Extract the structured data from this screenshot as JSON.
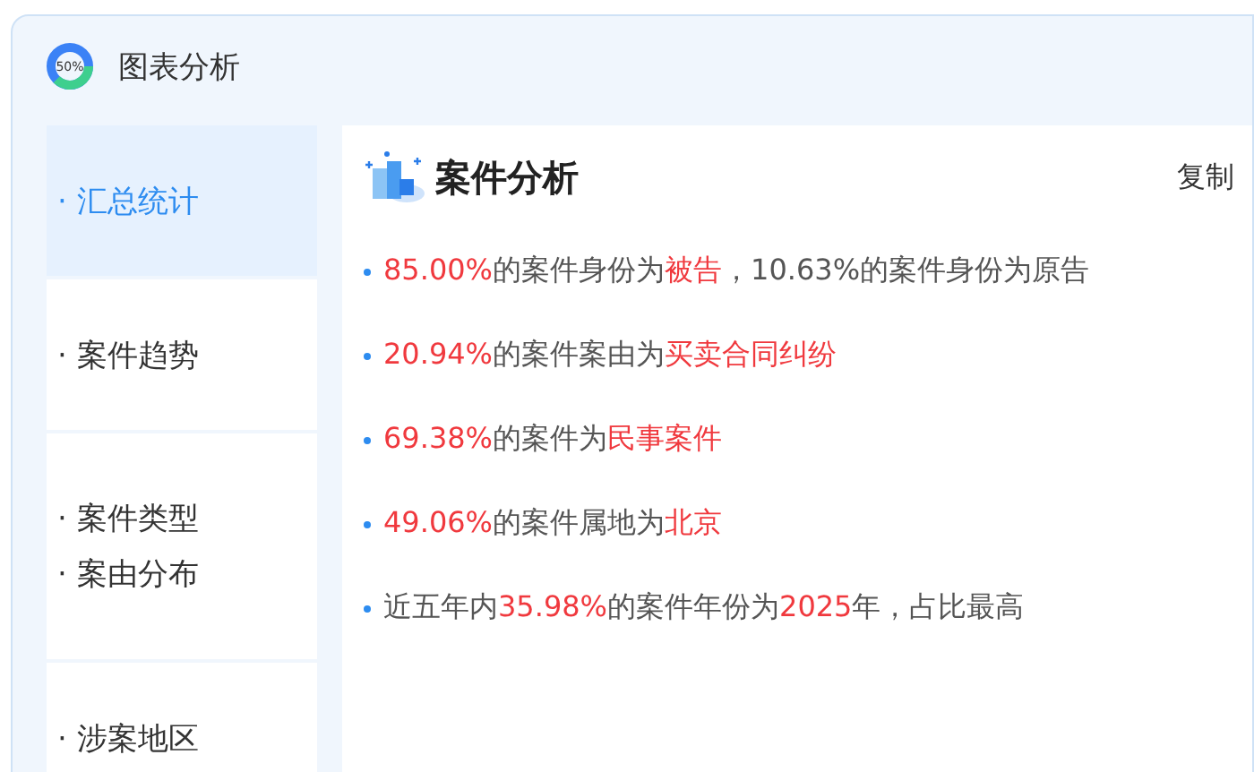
{
  "window": {
    "title": "图表分析",
    "logo_text": "50%"
  },
  "sidebar": {
    "items": [
      {
        "lines": [
          "· 汇总统计"
        ],
        "selected": true
      },
      {
        "lines": [
          "· 案件趋势"
        ],
        "selected": false
      },
      {
        "lines": [
          "· 案件类型",
          "· 案由分布"
        ],
        "selected": false
      },
      {
        "lines": [
          "· 涉案地区"
        ],
        "selected": false
      }
    ]
  },
  "panel": {
    "title": "案件分析",
    "copy_button": "复制",
    "bullets": [
      [
        {
          "text": "85.00%",
          "highlight": true
        },
        {
          "text": "的案件身份为",
          "highlight": false
        },
        {
          "text": "被告",
          "highlight": true
        },
        {
          "text": "，10.63%的案件身份为原告",
          "highlight": false
        }
      ],
      [
        {
          "text": "20.94%",
          "highlight": true
        },
        {
          "text": "的案件案由为",
          "highlight": false
        },
        {
          "text": "买卖合同纠纷",
          "highlight": true
        }
      ],
      [
        {
          "text": "69.38%",
          "highlight": true
        },
        {
          "text": "的案件为",
          "highlight": false
        },
        {
          "text": "民事案件",
          "highlight": true
        }
      ],
      [
        {
          "text": "49.06%",
          "highlight": true
        },
        {
          "text": "的案件属地为",
          "highlight": false
        },
        {
          "text": "北京",
          "highlight": true
        }
      ],
      [
        {
          "text": "近五年内",
          "highlight": false
        },
        {
          "text": "35.98%",
          "highlight": true
        },
        {
          "text": "的案件年份为",
          "highlight": false
        },
        {
          "text": "2025",
          "highlight": true
        },
        {
          "text": "年，占比最高",
          "highlight": false
        }
      ]
    ]
  }
}
